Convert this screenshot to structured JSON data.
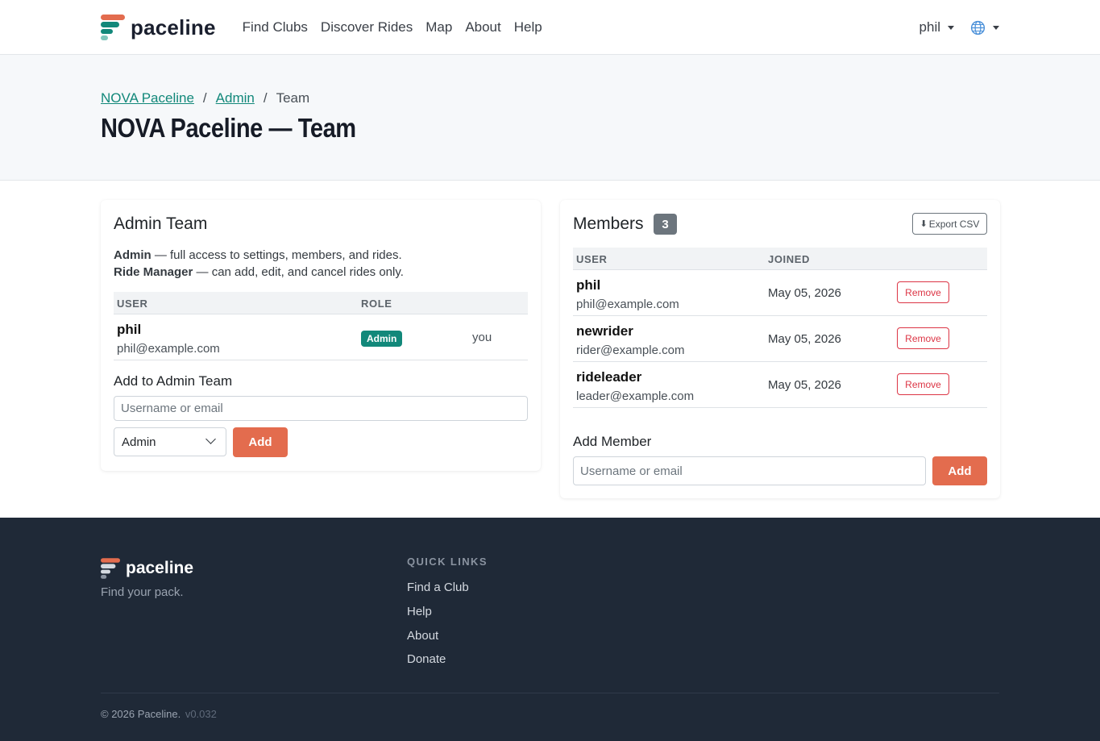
{
  "nav": {
    "brand": "paceline",
    "links": [
      "Find Clubs",
      "Discover Rides",
      "Map",
      "About",
      "Help"
    ],
    "user": "phil",
    "language_icon": "globe-icon"
  },
  "header": {
    "breadcrumb": [
      "NOVA Paceline",
      "Admin",
      "Team"
    ],
    "title": "NOVA Paceline — Team"
  },
  "admin_team": {
    "title": "Admin Team",
    "roles": [
      {
        "name": "Admin",
        "desc": " — full access to settings, members, and rides."
      },
      {
        "name": "Ride Manager",
        "desc": " — can add, edit, and cancel rides only."
      }
    ],
    "columns": [
      "USER",
      "ROLE"
    ],
    "rows": [
      {
        "name": "phil",
        "email": "phil@example.com",
        "role": "Admin",
        "note": "you"
      }
    ],
    "add_label": "Add to Admin Team",
    "input_placeholder": "Username or email",
    "role_select": "Admin",
    "add_button": "Add"
  },
  "members": {
    "title": "Members",
    "count": "3",
    "export_label": "Export CSV",
    "columns": [
      "USER",
      "JOINED"
    ],
    "rows": [
      {
        "name": "phil",
        "email": "phil@example.com",
        "joined": "May 05, 2026",
        "action": "Remove"
      },
      {
        "name": "newrider",
        "email": "rider@example.com",
        "joined": "May 05, 2026",
        "action": "Remove"
      },
      {
        "name": "rideleader",
        "email": "leader@example.com",
        "joined": "May 05, 2026",
        "action": "Remove"
      }
    ],
    "add_label": "Add Member",
    "input_placeholder": "Username or email",
    "add_button": "Add"
  },
  "footer": {
    "brand": "paceline",
    "tagline": "Find your pack.",
    "quick_links_title": "QUICK LINKS",
    "quick_links": [
      "Find a Club",
      "Help",
      "About",
      "Donate"
    ],
    "copyright": "© 2026 Paceline.",
    "version": "v0.032"
  },
  "colors": {
    "accent": "#12887a",
    "primary_button": "#e36c4e",
    "danger": "#dc3545",
    "footer_bg": "#1f2937"
  }
}
